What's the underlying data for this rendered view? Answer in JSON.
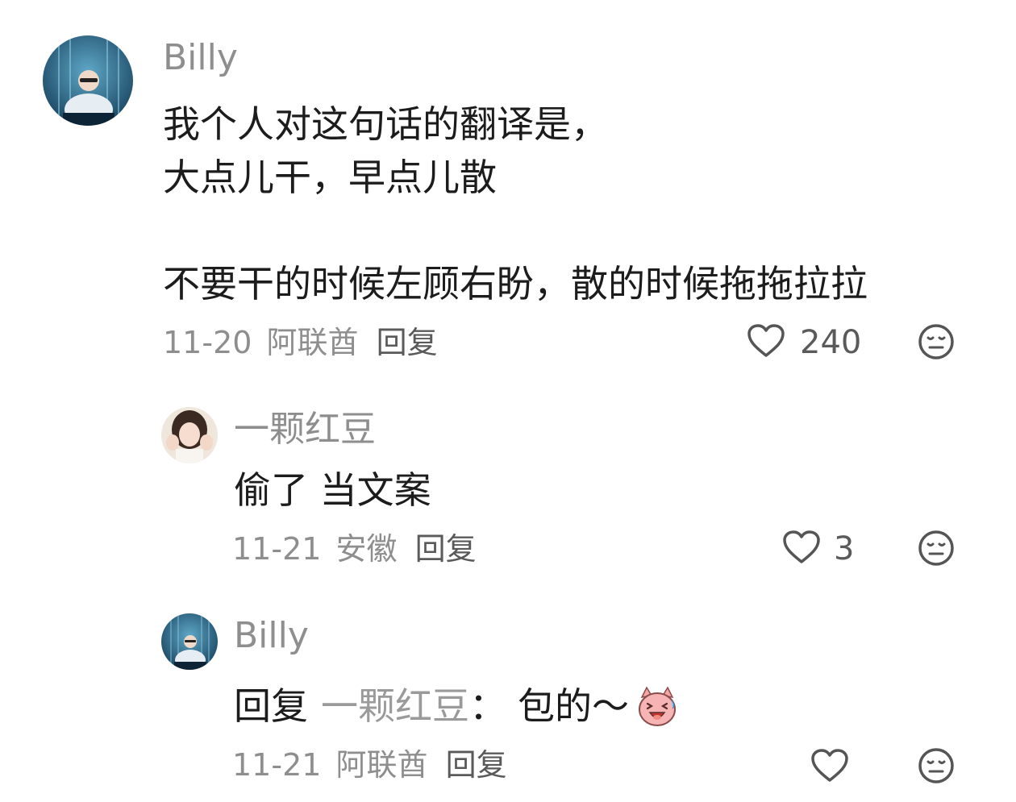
{
  "comments": [
    {
      "author": "Billy",
      "lines": [
        "我个人对这句话的翻译是，",
        "大点儿干，早点儿散",
        "不要干的时候左顾右盼，散的时候拖拖拉拉"
      ],
      "date": "11-20",
      "location": "阿联酋",
      "reply_label": "回复",
      "likes": "240"
    }
  ],
  "replies": [
    {
      "author": "一颗红豆",
      "text": "偷了 当文案",
      "date": "11-21",
      "location": "安徽",
      "reply_label": "回复",
      "likes": "3"
    },
    {
      "author": "Billy",
      "reply_prefix": "回复",
      "reply_target": "一颗红豆",
      "reply_colon": "：",
      "text": "包的～",
      "emoji": "laughing-pig-sticker",
      "date": "11-21",
      "location": "阿联酋",
      "reply_label": "回复",
      "likes": ""
    }
  ],
  "icons": {
    "like": "heart-outline-icon",
    "dislike": "neutral-face-icon"
  },
  "colors": {
    "text": "#1c1c1c",
    "secondary": "#8e8e8e",
    "icon": "#555555"
  }
}
